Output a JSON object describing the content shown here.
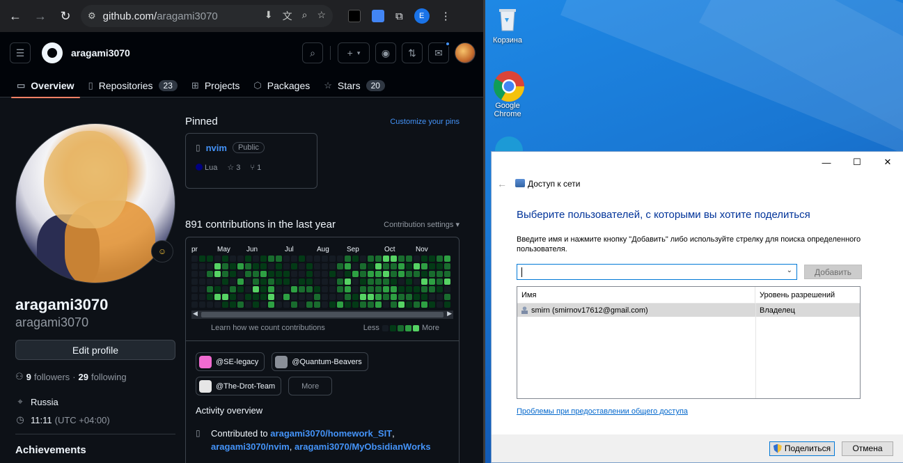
{
  "browser": {
    "url_host": "github.com/",
    "url_path": "aragami3070",
    "profile_initial": "E"
  },
  "github": {
    "username": "aragami3070",
    "tabs": [
      {
        "label": "Overview",
        "count": null
      },
      {
        "label": "Repositories",
        "count": "23"
      },
      {
        "label": "Projects",
        "count": null
      },
      {
        "label": "Packages",
        "count": null
      },
      {
        "label": "Stars",
        "count": "20"
      }
    ],
    "profile": {
      "name": "aragami3070",
      "login": "aragami3070",
      "edit_label": "Edit profile",
      "followers_count": "9",
      "followers_label": "followers",
      "following_count": "29",
      "following_label": "following",
      "location": "Russia",
      "time": "11:11",
      "timezone": "(UTC +04:00)",
      "achievements": "Achievements"
    },
    "pinned": {
      "title": "Pinned",
      "customize": "Customize your pins",
      "repo": {
        "name": "nvim",
        "visibility": "Public",
        "language": "Lua",
        "stars": "3",
        "forks": "1"
      }
    },
    "contributions": {
      "title": "891 contributions in the last year",
      "settings": "Contribution settings",
      "months": [
        "pr",
        "May",
        "Jun",
        "Jul",
        "Aug",
        "Sep",
        "Oct",
        "Nov"
      ],
      "learn": "Learn how we count contributions",
      "less": "Less",
      "more": "More",
      "colors": [
        "#151b23",
        "#033a16",
        "#196c2e",
        "#2ea043",
        "#56d364"
      ]
    },
    "orgs": [
      "@SE-legacy",
      "@Quantum-Beavers",
      "@The-Drot-Team"
    ],
    "orgs_more": "More",
    "activity": {
      "title": "Activity overview",
      "contributed_to": "Contributed to",
      "repo1": "aragami3070/homework_SIT",
      "comma1": ",",
      "repo2": "aragami3070/nvim",
      "comma2": ",",
      "repo3": "aragami3070/MyObsidianWorks"
    }
  },
  "desktop": {
    "icons": [
      {
        "label": "Корзина"
      },
      {
        "label": "Google Chrome"
      }
    ]
  },
  "dialog": {
    "nav_title": "Доступ к сети",
    "heading": "Выберите пользователей, с которыми вы хотите поделиться",
    "description": "Введите имя и нажмите кнопку \"Добавить\" либо используйте стрелку для поиска определенного пользователя.",
    "input_value": "",
    "add_label": "Добавить",
    "col_name": "Имя",
    "col_level": "Уровень разрешений",
    "rows": [
      {
        "name": "smirn (smirnov17612@gmail.com)",
        "level": "Владелец"
      }
    ],
    "help_link": "Проблемы при предоставлении общего доступа",
    "share_label": "Поделиться",
    "cancel_label": "Отмена"
  }
}
